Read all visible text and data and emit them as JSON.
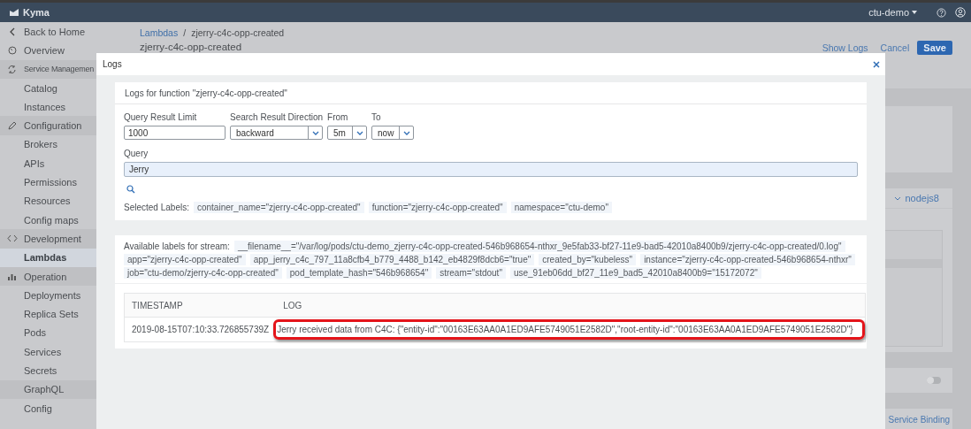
{
  "topbar": {
    "brand": "Kyma",
    "namespace": "ctu-demo"
  },
  "sidebar": {
    "items": [
      {
        "label": "Back to Home",
        "kind": "back",
        "selected": false
      },
      {
        "label": "Overview",
        "kind": "overview",
        "selected": false
      },
      {
        "label": "Service Managemen",
        "kind": "services",
        "selected": false
      },
      {
        "label": "Catalog",
        "kind": "item",
        "selected": false
      },
      {
        "label": "Instances",
        "kind": "item",
        "selected": false
      },
      {
        "label": "Configuration",
        "kind": "configuration",
        "selected": false
      },
      {
        "label": "Brokers",
        "kind": "item",
        "selected": false
      },
      {
        "label": "APIs",
        "kind": "item",
        "selected": false
      },
      {
        "label": "Permissions",
        "kind": "item",
        "selected": false
      },
      {
        "label": "Resources",
        "kind": "item",
        "selected": false
      },
      {
        "label": "Config maps",
        "kind": "item",
        "selected": false
      },
      {
        "label": "Development",
        "kind": "development",
        "selected": false
      },
      {
        "label": "Lambdas",
        "kind": "item",
        "selected": true
      },
      {
        "label": "Operation",
        "kind": "operation",
        "selected": false
      },
      {
        "label": "Deployments",
        "kind": "item",
        "selected": false
      },
      {
        "label": "Replica Sets",
        "kind": "item",
        "selected": false
      },
      {
        "label": "Pods",
        "kind": "item",
        "selected": false
      },
      {
        "label": "Services",
        "kind": "item",
        "selected": false
      },
      {
        "label": "Secrets",
        "kind": "item",
        "selected": false
      },
      {
        "label": "GraphQL",
        "kind": "category",
        "selected": false
      },
      {
        "label": "Config",
        "kind": "item",
        "selected": false
      }
    ]
  },
  "page": {
    "breadcrumb": {
      "link": "Lambdas",
      "separator": "/",
      "current": "zjerry-c4c-opp-created"
    },
    "title": "zjerry-c4c-opp-created",
    "actions": [
      {
        "label": "Show Logs",
        "kind": "link"
      },
      {
        "label": "Cancel",
        "kind": "link"
      },
      {
        "label": "Save",
        "kind": "primary"
      }
    ],
    "runtime": "nodejs8",
    "toggle": {
      "on": false
    },
    "service_binding": "Service Binding"
  },
  "modal": {
    "title": "Logs",
    "heading": "Logs for function \"zjerry-c4c-opp-created\"",
    "fields": [
      {
        "label": "Query Result Limit",
        "kind": "input",
        "value": "1000"
      },
      {
        "label": "Search Result Direction",
        "kind": "select",
        "value": "backward"
      },
      {
        "label": "From",
        "kind": "select",
        "value": "5m"
      },
      {
        "label": "To",
        "kind": "select",
        "value": "now"
      }
    ],
    "query": {
      "label": "Query",
      "value": "Jerry"
    },
    "selected_labels": {
      "label": "Selected Labels:",
      "chips": [
        "container_name=\"zjerry-c4c-opp-created\"",
        "function=\"zjerry-c4c-opp-created\"",
        "namespace=\"ctu-demo\""
      ]
    },
    "available_labels": {
      "label": "Available labels for stream:",
      "lines": [
        [
          "__filename__=\"/var/log/pods/ctu-demo_zjerry-c4c-opp-created-546b968654-nthxr_9e5fab33-bf27-11e9-bad5-42010a8400b9/zjerry-c4c-opp-created/0.log\""
        ],
        [
          "app=\"zjerry-c4c-opp-created\"",
          "app_jerry_c4c_797_11a8cfb4_b779_4488_b142_eb4829f8dcb6=\"true\"",
          "created_by=\"kubeless\"",
          "instance=\"zjerry-c4c-opp-created-546b968654-nthxr\""
        ],
        [
          "job=\"ctu-demo/zjerry-c4c-opp-created\"",
          "pod_template_hash=\"546b968654\"",
          "stream=\"stdout\"",
          "use_91eb06dd_bf27_11e9_bad5_42010a8400b9=\"15172072\""
        ]
      ]
    },
    "table": {
      "columns": [
        "TIMESTAMP",
        "LOG"
      ],
      "rows": [
        {
          "cells": [
            "2019-08-15T07:10:33.726855739Z",
            "Jerry received data from C4C: {\"entity-id\":\"00163E63AA0A1ED9AFE5749051E2582D\",\"root-entity-id\":\"00163E63AA0A1ED9AFE5749051E2582D\"}"
          ],
          "highlighted": true
        }
      ]
    }
  }
}
